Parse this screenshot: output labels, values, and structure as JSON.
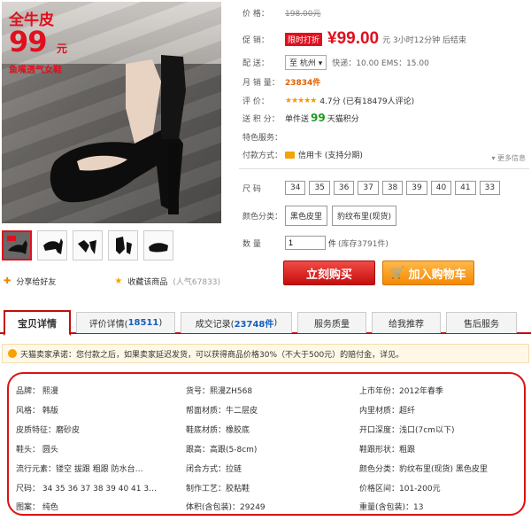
{
  "main_image": {
    "promo_top": "全牛皮",
    "promo_price": "99",
    "promo_unit": "元",
    "promo_sub": "鱼嘴透气女鞋"
  },
  "thumbnails": [
    "thumb-1",
    "thumb-2",
    "thumb-3",
    "thumb-4",
    "thumb-5"
  ],
  "share": {
    "share_label": "分享给好友",
    "fav_label": "收藏该商品",
    "popularity": "(人气67833)"
  },
  "info": {
    "price_label": "价    格：",
    "original_price": "198.00元",
    "promo_label": "促    销：",
    "promo_tag": "限时打折",
    "current_price": "¥99.00",
    "promo_suffix": "元  3小时12分钟  后结束",
    "ship_label": "配    送：",
    "ship_from": "至 杭州",
    "ship_text": "快递：10.00  EMS：15.00",
    "sales_label": "月 销 量：",
    "sales_value": "23834件",
    "rating_label": "评    价：",
    "rating_stars": "★★★★★",
    "rating_text": "4.7分 (已有18479人评论)",
    "points_label": "送 积 分：",
    "points_prefix": "单件送",
    "points_value": "99",
    "points_suffix": "天猫积分",
    "special_label": "特色服务：",
    "payment_label": "付款方式：",
    "payment_value": "信用卡 (支持分期)",
    "more_label": "▾ 更多信息",
    "size_label": "尺    码",
    "sizes": [
      "34",
      "35",
      "36",
      "37",
      "38",
      "39",
      "40",
      "41",
      "33"
    ],
    "color_label": "颜色分类：",
    "colors": [
      "黑色皮里",
      "豹纹布里(现货)"
    ],
    "qty_label": "数    量",
    "qty_value": "1",
    "qty_suffix": "件",
    "stock": "(库存3791件)",
    "buy_button": "立刻购买",
    "cart_button": "加入购物车"
  },
  "tabs": [
    {
      "label": "宝贝详情",
      "count": ""
    },
    {
      "label": "评价详情(",
      "count": "18511",
      "tail": ")"
    },
    {
      "label": "成交记录(",
      "count": "23748件",
      "tail": ")"
    },
    {
      "label": "服务质量",
      "count": ""
    },
    {
      "label": "给我推荐",
      "count": ""
    },
    {
      "label": "售后服务",
      "count": ""
    }
  ],
  "promise": "天猫卖家承诺：您付款之后，如果卖家延迟发货，可以获得商品价格30%（不大于500元）的赔付金，详见。",
  "attributes": [
    [
      "品牌：   熙漫",
      "货号：熙漫ZH568",
      "上市年份：2012年春季"
    ],
    [
      "风格：   韩版",
      "帮面材质：牛二层皮",
      "内里材质：超纤"
    ],
    [
      "皮质特征：磨砂皮",
      "鞋底材质：橡胶底",
      "开口深度：浅口(7cm以下)"
    ],
    [
      "鞋头：   圆头",
      "跟高：高跟(5-8cm)",
      "鞋跟形状：粗跟"
    ],
    [
      "流行元素：镂空 拔跟 粗跟 防水台…",
      "闭合方式：拉链",
      "颜色分类：豹纹布里(现货) 黑色皮里"
    ],
    [
      "尺码：   34 35 36 37 38 39 40 41 3…",
      "制作工艺：胶粘鞋",
      "价格区间：101-200元"
    ],
    [
      "图案：   纯色",
      "体积(含包装)：29249",
      "重量(含包装)：13"
    ]
  ]
}
